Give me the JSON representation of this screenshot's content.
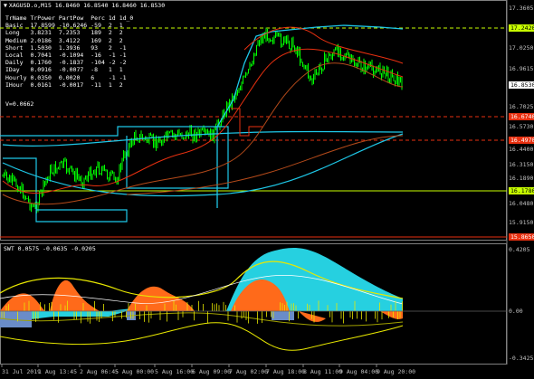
{
  "chart": {
    "title": "XAGUSD.o,M15  16.8460 16.8540 16.8460 16.8530",
    "title_icon": "triangle-down-icon",
    "v_label": "V=0.0662"
  },
  "trend_table": {
    "headers": [
      "TrName",
      "TrPower",
      "PartPow",
      "Perc",
      "1d",
      "1d_0"
    ],
    "rows": [
      [
        "Basic",
        "17.8599",
        "-10.6246",
        "-59",
        "2",
        "1"
      ],
      [
        "Long",
        "3.8231",
        "7.2353",
        "189",
        "2",
        "2"
      ],
      [
        "Medium",
        "2.0186",
        "3.4122",
        "169",
        "2",
        "2"
      ],
      [
        "Short",
        "1.5030",
        "1.3936",
        "93",
        "2",
        "-1"
      ],
      [
        "Local",
        "0.7041",
        "-0.1094",
        "-16",
        "-1",
        "-1"
      ],
      [
        "Daily",
        "0.1760",
        "-0.1837",
        "-104",
        "-2",
        "-2"
      ],
      [
        "IDay",
        "0.0916",
        "-0.0077",
        "-8",
        "1",
        "1"
      ],
      [
        "Hourly",
        "0.0350",
        "0.0020",
        "6",
        "-1",
        "-1"
      ],
      [
        "IHour",
        "0.0161",
        "-0.0017",
        "-11",
        "1",
        "2"
      ]
    ]
  },
  "price_axis": [
    "17.3605",
    "17.2420",
    "17.0250",
    "16.9615",
    "16.8530",
    "16.7025",
    "16.6740",
    "16.5730",
    "16.4970",
    "16.4400",
    "16.3150",
    "16.1890",
    "16.1780",
    "16.0480",
    "15.9150",
    "15.8650"
  ],
  "price_tags": [
    {
      "text": "17.2420",
      "bg": "#c8ff00",
      "fg": "#000000"
    },
    {
      "text": "16.8530",
      "bg": "#ffffff",
      "fg": "#000000"
    },
    {
      "text": "16.6740",
      "bg": "#e83010",
      "fg": "#ffffff"
    },
    {
      "text": "16.4970",
      "bg": "#e83010",
      "fg": "#ffffff"
    },
    {
      "text": "16.1780",
      "bg": "#c8ff00",
      "fg": "#000000"
    },
    {
      "text": "15.8650",
      "bg": "#e83010",
      "fg": "#ffffff"
    }
  ],
  "indicator": {
    "label": "SWT 0.0575 -0.0635 -0.0205",
    "axis": [
      "0.4205",
      "0.00",
      "-0.3425"
    ]
  },
  "time_axis": [
    "31 Jul 2019",
    "1 Aug 13:45",
    "2 Aug 06:45",
    "5 Aug 00:00",
    "5 Aug 16:00",
    "6 Aug 09:00",
    "7 Aug 02:00",
    "7 Aug 18:00",
    "8 Aug 11:00",
    "9 Aug 04:00",
    "9 Aug 20:00"
  ],
  "colors": {
    "candles": "#00ff00",
    "cyan_line": "#1ec8e8",
    "red_line": "#e83010",
    "yellow_line": "#e8e800",
    "brown_line": "#b44a1a",
    "dashed_red": "#e83010",
    "dashed_yellow": "#c8ff00",
    "grid": "#2a2a2a"
  }
}
